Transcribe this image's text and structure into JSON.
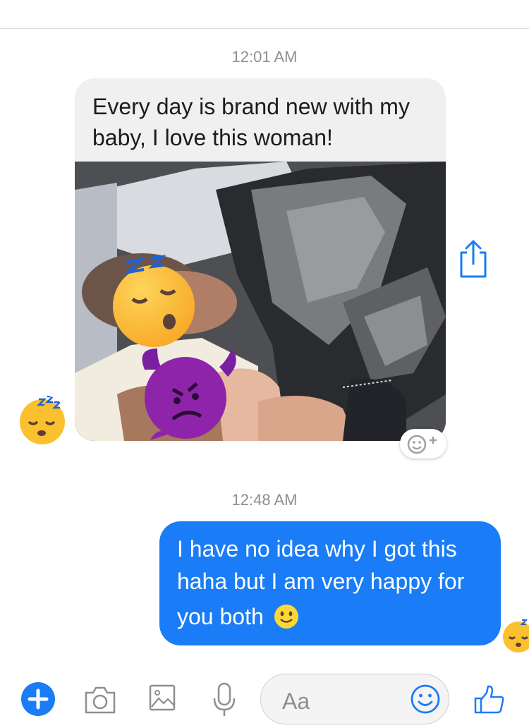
{
  "conversation": {
    "messages": [
      {
        "timestamp": "12:01 AM",
        "direction": "incoming",
        "text": "Every day is brand new with my baby, I love this woman!",
        "has_photo": true,
        "photo_description_icons": [
          "sleeping-face-emoji",
          "angry-devil-emoji"
        ]
      },
      {
        "timestamp": "12:48 AM",
        "direction": "outgoing",
        "text_lines": [
          "I have no idea why I got this",
          "haha but I am very happy for",
          "you both"
        ],
        "trailing_emoji": "slightly-smiling-face-emoji"
      }
    ]
  },
  "composer": {
    "placeholder": "Aa",
    "icons": [
      "plus-icon",
      "camera-icon",
      "gallery-icon",
      "microphone-icon",
      "emoji-icon",
      "thumbs-up-icon"
    ]
  },
  "colors": {
    "outgoing_bubble": "#1a7cf6",
    "incoming_bubble": "#f0f0f0",
    "accent": "#1a7cf6",
    "timestamp": "#8e8e93"
  }
}
